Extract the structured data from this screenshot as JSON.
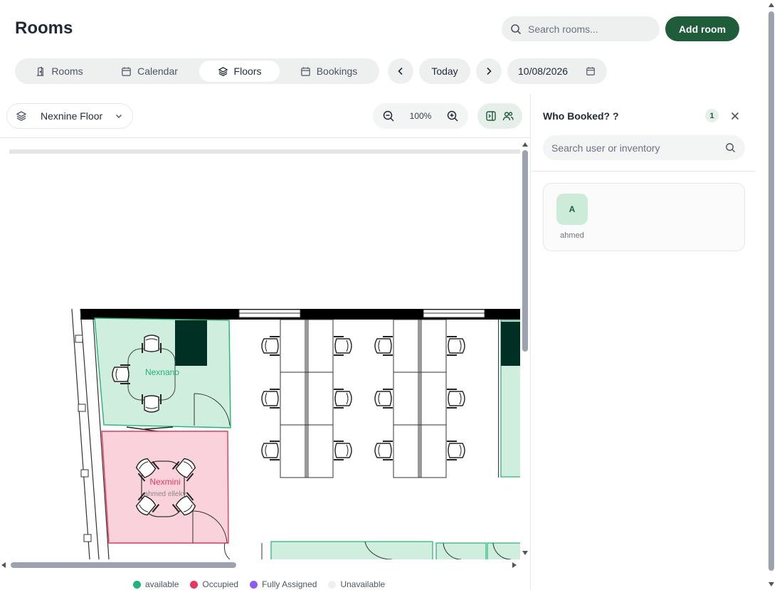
{
  "header": {
    "title": "Rooms",
    "search_placeholder": "Search rooms...",
    "add_room_label": "Add room"
  },
  "tabs": [
    {
      "label": "Rooms",
      "icon": "door-icon"
    },
    {
      "label": "Calendar",
      "icon": "calendar-icon"
    },
    {
      "label": "Floors",
      "icon": "layers-icon",
      "active": true
    },
    {
      "label": "Bookings",
      "icon": "calendar-icon"
    }
  ],
  "date_nav": {
    "today_label": "Today",
    "date_value": "10/08/2026"
  },
  "floor": {
    "selected": "Nexnine Floor",
    "zoom": "100%"
  },
  "floorplan": {
    "rooms": [
      {
        "name": "Nexnano",
        "status": "available",
        "booked_by": ""
      },
      {
        "name": "Nexmini",
        "status": "occupied",
        "booked_by": "ahmed elleky"
      }
    ]
  },
  "legend": [
    {
      "label": "available",
      "color": "#1fb57a"
    },
    {
      "label": "Occupied",
      "color": "#e5385a"
    },
    {
      "label": "Fully Assigned",
      "color": "#8b5cf6"
    },
    {
      "label": "Unavailable",
      "color": "#eef0f0"
    }
  ],
  "panel": {
    "title": "Who Booked? ?",
    "count": "1",
    "search_placeholder": "Search user or inventory",
    "users": [
      {
        "initial": "A",
        "name": "ahmed"
      }
    ]
  },
  "colors": {
    "primary": "#1e5c3a",
    "available_fill": "#cfeedd",
    "occupied_fill": "#f9d2dc"
  }
}
